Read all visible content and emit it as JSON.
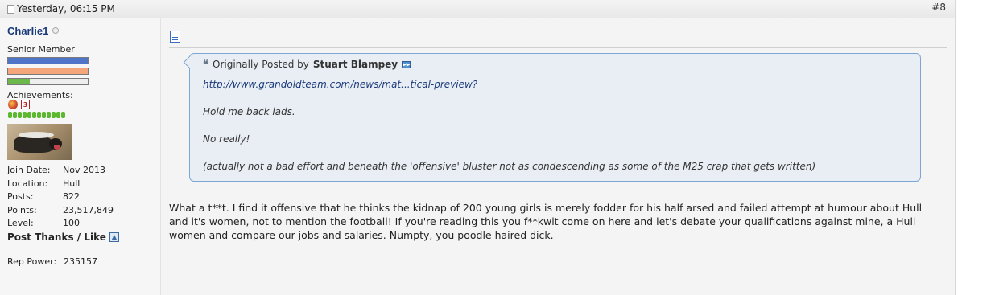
{
  "post_header": {
    "date": "Yesterday, 06:15 PM",
    "post_number": "#8"
  },
  "user": {
    "username": "Charlie1",
    "rank": "Senior Member",
    "achievements_label": "Achievements:",
    "achievement_icons": [
      "achievement-medal-icon",
      "achievement-badge-icon"
    ],
    "bar_levels": {
      "bar1": 1.0,
      "bar2": 1.0,
      "bar3": 0.27
    },
    "colors": {
      "bar1": "#4f74c8",
      "bar2": "#f5a57a",
      "bar3": "#6ab94a",
      "username": "#1b3a7a"
    },
    "details": [
      {
        "label": "Join Date:",
        "value": "Nov 2013"
      },
      {
        "label": "Location:",
        "value": "Hull"
      },
      {
        "label": "Posts:",
        "value": "822"
      },
      {
        "label": "Points:",
        "value": "23,517,849"
      },
      {
        "label": "Level:",
        "value": "100"
      }
    ],
    "post_thanks_label": "Post Thanks / Like",
    "rep_power_label": "Rep Power:",
    "rep_power_value": "235157"
  },
  "quote": {
    "prefix": "Originally Posted by",
    "author": "Stuart Blampey",
    "link": "http://www.grandoldteam.com/news/mat...tical-preview?",
    "lines": [
      "Hold me back lads.",
      "No really!",
      "(actually not a bad effort and beneath the 'offensive' bluster not as condescending as some of the M25 crap that gets written)"
    ]
  },
  "message": "What a t**t. I find it offensive that he thinks the kidnap of 200 young girls is merely fodder for his half arsed and failed attempt at humour about Hull and it's women, not to mention the football! If you're reading this you f**kwit come on here and let's debate your qualifications against mine, a Hull women and compare our jobs and salaries. Numpty, you poodle haired dick."
}
